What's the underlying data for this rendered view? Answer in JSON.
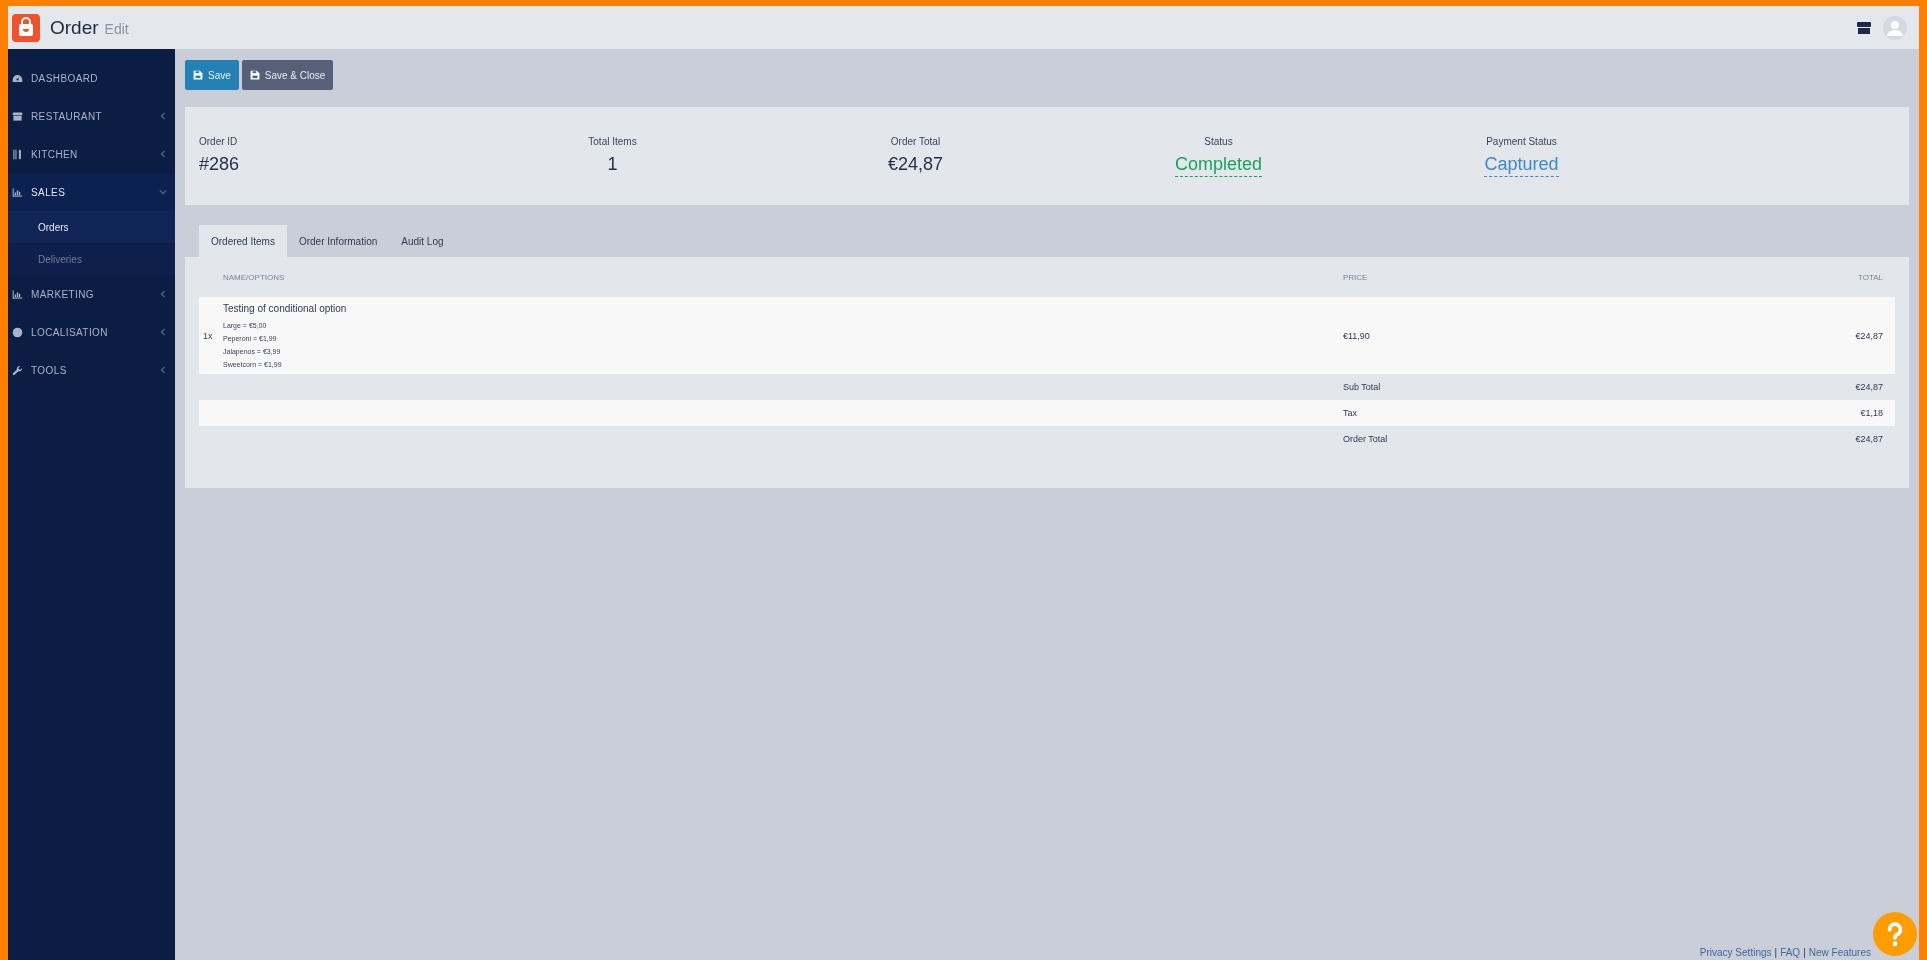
{
  "header": {
    "title": "Order",
    "subtitle": "Edit"
  },
  "sidebar": {
    "items": [
      {
        "label": "DASHBOARD",
        "kind": "link"
      },
      {
        "label": "RESTAURANT",
        "kind": "group",
        "expanded": false
      },
      {
        "label": "KITCHEN",
        "kind": "group",
        "expanded": false
      },
      {
        "label": "SALES",
        "kind": "group",
        "expanded": true,
        "children": [
          {
            "label": "Orders",
            "selected": true
          },
          {
            "label": "Deliveries",
            "selected": false
          }
        ]
      },
      {
        "label": "MARKETING",
        "kind": "group",
        "expanded": false
      },
      {
        "label": "LOCALISATION",
        "kind": "group",
        "expanded": false
      },
      {
        "label": "TOOLS",
        "kind": "group",
        "expanded": false
      }
    ]
  },
  "toolbar": {
    "buttons": [
      {
        "label": "Save",
        "kind": "primary"
      },
      {
        "label": "Save & Close",
        "kind": "secondary"
      }
    ]
  },
  "stats": [
    {
      "label": "Order ID",
      "value": "#286",
      "kind": "plain"
    },
    {
      "label": "Total Items",
      "value": "1",
      "kind": "plain"
    },
    {
      "label": "Order Total",
      "value": "€24,87",
      "kind": "plain"
    },
    {
      "label": "Status",
      "value": "Completed",
      "kind": "status",
      "color": "#17a55b"
    },
    {
      "label": "Payment Status",
      "value": "Captured",
      "kind": "status",
      "color": "#3a8cc1"
    }
  ],
  "tabs": [
    {
      "label": "Ordered Items",
      "selected": true
    },
    {
      "label": "Order Information",
      "selected": false
    },
    {
      "label": "Audit Log",
      "selected": false
    }
  ],
  "table": {
    "columns": [
      "NAME/OPTIONS",
      "PRICE",
      "TOTAL"
    ],
    "rows": [
      {
        "qty": "1x",
        "name": "Testing of conditional option",
        "options": [
          "Large = €5,00",
          "Peperoni = €1,99",
          "Jalapenos = €3,99",
          "Sweetcorn = €1,99"
        ],
        "price": "€11,90",
        "total": "€24,87"
      }
    ],
    "summary": [
      {
        "label": "Sub Total",
        "value": "€24,87"
      },
      {
        "label": "Tax",
        "value": "€1,18"
      },
      {
        "label": "Order Total",
        "value": "€24,87"
      }
    ]
  },
  "footer": {
    "links": [
      "Privacy Settings",
      "FAQ",
      "New Features"
    ],
    "separator": "|"
  }
}
